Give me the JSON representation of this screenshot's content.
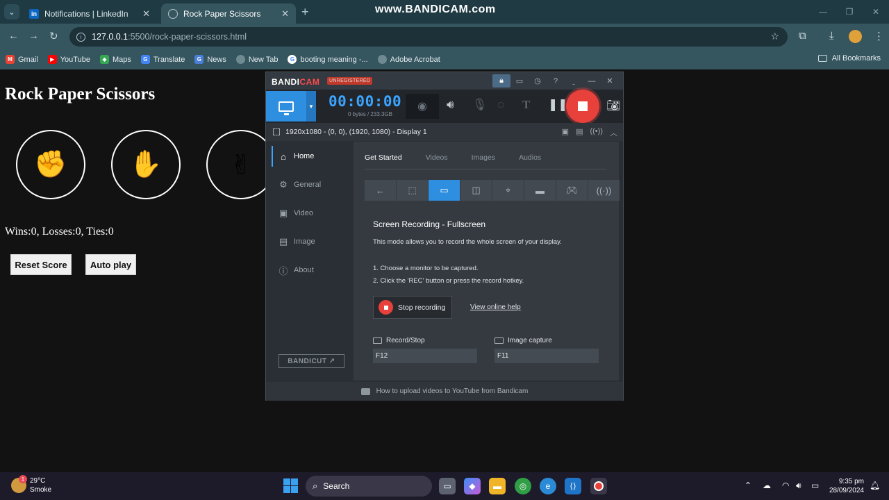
{
  "browser": {
    "tabs": [
      {
        "title": "Notifications | LinkedIn",
        "favicon": "linkedin-icon",
        "active": false
      },
      {
        "title": "Rock Paper Scissors",
        "favicon": "globe-icon",
        "active": true
      }
    ],
    "watermark": "www.BANDICAM.com",
    "url_host": "127.0.0.1",
    "url_rest": ":5500/rock-paper-scissors.html",
    "bookmarks": [
      {
        "label": "Gmail",
        "icon": "gmail-icon",
        "color": "#ea4335"
      },
      {
        "label": "YouTube",
        "icon": "youtube-icon",
        "color": "#ff0000"
      },
      {
        "label": "Maps",
        "icon": "maps-icon",
        "color": "#34a853"
      },
      {
        "label": "Translate",
        "icon": "translate-icon",
        "color": "#4285f4"
      },
      {
        "label": "News",
        "icon": "news-icon",
        "color": "#4a7fd8"
      },
      {
        "label": "New Tab",
        "icon": "globe-icon",
        "color": "#6f8a91"
      },
      {
        "label": "booting meaning -...",
        "icon": "google-icon",
        "color": "#ffffff"
      },
      {
        "label": "Adobe Acrobat",
        "icon": "globe-icon",
        "color": "#6f8a91"
      }
    ],
    "all_bookmarks": "All Bookmarks"
  },
  "page": {
    "title": "Rock Paper Scissors",
    "moves": [
      {
        "name": "rock",
        "glyph": "✊"
      },
      {
        "name": "paper",
        "glyph": "✋"
      },
      {
        "name": "scissors",
        "glyph": "✌"
      }
    ],
    "score": "Wins:0, Losses:0, Ties:0",
    "reset_label": "Reset Score",
    "autoplay_label": "Auto play"
  },
  "bandicam": {
    "logo_a": "BANDI",
    "logo_b": "CAM",
    "unregistered": "UNREGISTERED",
    "timer": "00:00:00",
    "storage": "0 bytes / 233.3GB",
    "display_info": "1920x1080 - (0, 0), (1920, 1080) - Display 1",
    "sidebar": [
      {
        "label": "Home",
        "icon": "home-icon",
        "active": true
      },
      {
        "label": "General",
        "icon": "gear-icon",
        "active": false
      },
      {
        "label": "Video",
        "icon": "video-icon",
        "active": false
      },
      {
        "label": "Image",
        "icon": "image-icon",
        "active": false
      },
      {
        "label": "About",
        "icon": "info-icon",
        "active": false
      }
    ],
    "bandicut": "BANDICUT",
    "tabs": [
      "Get Started",
      "Videos",
      "Images",
      "Audios"
    ],
    "active_tab": "Get Started",
    "heading": "Screen Recording - Fullscreen",
    "description": "This mode allows you to record the whole screen of your display.",
    "step1": "1. Choose a monitor to be captured.",
    "step2": "2. Click the 'REC' button or press the record hotkey.",
    "stop_label": "Stop recording",
    "help_link": "View online help",
    "hotkey_record_label": "Record/Stop",
    "hotkey_record_value": "F12",
    "hotkey_image_label": "Image capture",
    "hotkey_image_value": "F11",
    "footer": "How to upload videos to YouTube from Bandicam",
    "accent": "#2e8ee0",
    "rec_color": "#e8403b"
  },
  "taskbar": {
    "temp": "29°C",
    "condition": "Smoke",
    "weather_badge": "1",
    "search": "Search",
    "time": "9:35 pm",
    "date": "28/09/2024"
  }
}
